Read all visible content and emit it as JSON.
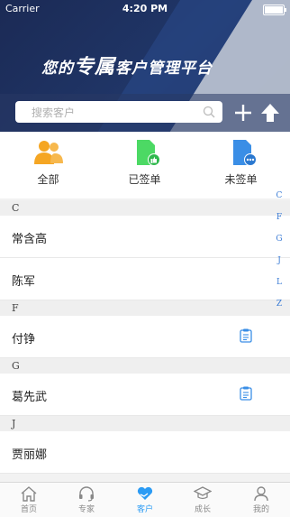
{
  "status_bar": {
    "carrier": "Carrier",
    "time": "4:20 PM"
  },
  "banner": {
    "slogan_pre": "您的",
    "slogan_big": "专属",
    "slogan_post": "客户管理平台"
  },
  "search": {
    "placeholder": "搜索客户"
  },
  "categories": [
    {
      "label": "全部",
      "icon": "people-icon",
      "color": "#f5a623"
    },
    {
      "label": "已签单",
      "icon": "doc-thumb-icon",
      "color": "#4cd964"
    },
    {
      "label": "未签单",
      "icon": "doc-more-icon",
      "color": "#3a8ee6"
    }
  ],
  "list": {
    "sections": [
      {
        "letter": "C",
        "items": [
          "常含高",
          "陈军"
        ]
      },
      {
        "letter": "F",
        "items": [
          "付铮"
        ]
      },
      {
        "letter": "G",
        "items": [
          "葛先武"
        ]
      },
      {
        "letter": "J",
        "items": [
          "贾丽娜"
        ]
      }
    ]
  },
  "index_letters": [
    "C",
    "F",
    "G",
    "J",
    "L",
    "Z"
  ],
  "tabs": [
    {
      "label": "首页",
      "icon": "home-icon"
    },
    {
      "label": "专家",
      "icon": "headset-icon"
    },
    {
      "label": "客户",
      "icon": "heart-hands-icon",
      "active": true
    },
    {
      "label": "成长",
      "icon": "grad-cap-icon"
    },
    {
      "label": "我的",
      "icon": "user-icon"
    }
  ],
  "colors": {
    "accent": "#2b9bf4",
    "banner": "#1b2a55"
  }
}
